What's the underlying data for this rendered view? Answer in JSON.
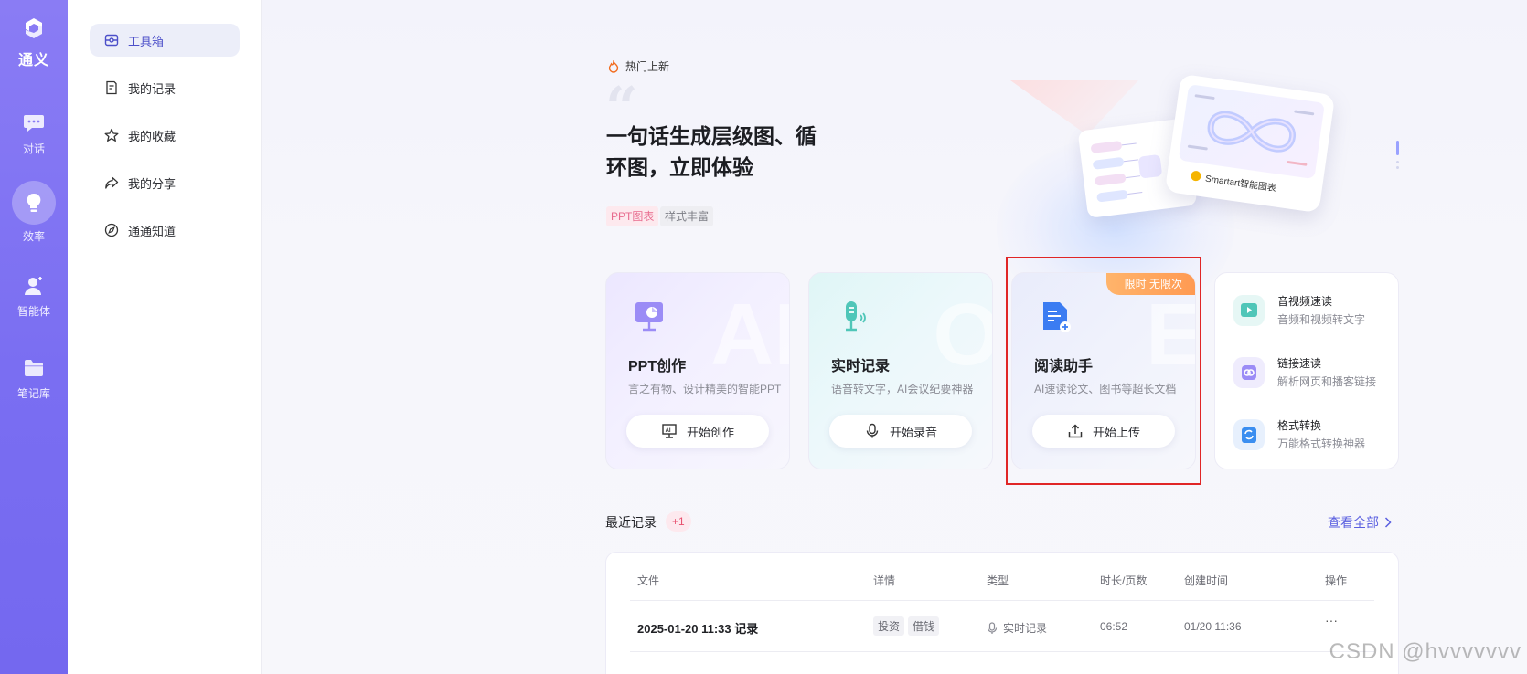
{
  "rail": {
    "logo": "通义",
    "items": [
      {
        "label": "对话",
        "icon": "chat-icon"
      },
      {
        "label": "效率",
        "icon": "lightbulb-icon"
      },
      {
        "label": "智能体",
        "icon": "agent-icon"
      },
      {
        "label": "笔记库",
        "icon": "folder-icon"
      }
    ]
  },
  "sidebar": {
    "items": [
      {
        "label": "工具箱",
        "icon": "toolbox-icon"
      },
      {
        "label": "我的记录",
        "icon": "record-icon"
      },
      {
        "label": "我的收藏",
        "icon": "star-icon"
      },
      {
        "label": "我的分享",
        "icon": "share-icon"
      },
      {
        "label": "通通知道",
        "icon": "compass-icon"
      }
    ]
  },
  "hero": {
    "tag": "热门上新",
    "title_line1": "一句话生成层级图、循",
    "title_line2": "环图，立即体验",
    "chip1": "PPT图表",
    "chip2": "样式丰富",
    "preview_label": "Smartart智能图表"
  },
  "cards": [
    {
      "title": "PPT创作",
      "desc": "言之有物、设计精美的智能PPT",
      "button": "开始创作",
      "ghost": "AI"
    },
    {
      "title": "实时记录",
      "desc": "语音转文字，AI会议纪要神器",
      "button": "开始录音",
      "ghost": "O"
    },
    {
      "title": "阅读助手",
      "desc": "AI速读论文、图书等超长文档",
      "button": "开始上传",
      "badge": "限时 无限次",
      "ghost": "E"
    }
  ],
  "mini_tools": [
    {
      "title": "音视频速读",
      "desc": "音频和视频转文字",
      "icon": "video-icon",
      "color": "#4fc6b8"
    },
    {
      "title": "链接速读",
      "desc": "解析网页和播客链接",
      "icon": "link-icon",
      "color": "#8a7cf4"
    },
    {
      "title": "格式转换",
      "desc": "万能格式转换神器",
      "icon": "convert-icon",
      "color": "#3b8ef0"
    }
  ],
  "recent": {
    "title": "最近记录",
    "count": "+1",
    "see_all": "查看全部",
    "columns": [
      "文件",
      "详情",
      "类型",
      "时长/页数",
      "创建时间",
      "操作"
    ],
    "rows": [
      {
        "file": "2025-01-20 11:33 记录",
        "tags": [
          "投资",
          "借钱"
        ],
        "type": "实时记录",
        "duration": "06:52",
        "created": "01/20 11:36",
        "action": "···"
      }
    ]
  },
  "watermark": "CSDN @hvvvvvvv"
}
